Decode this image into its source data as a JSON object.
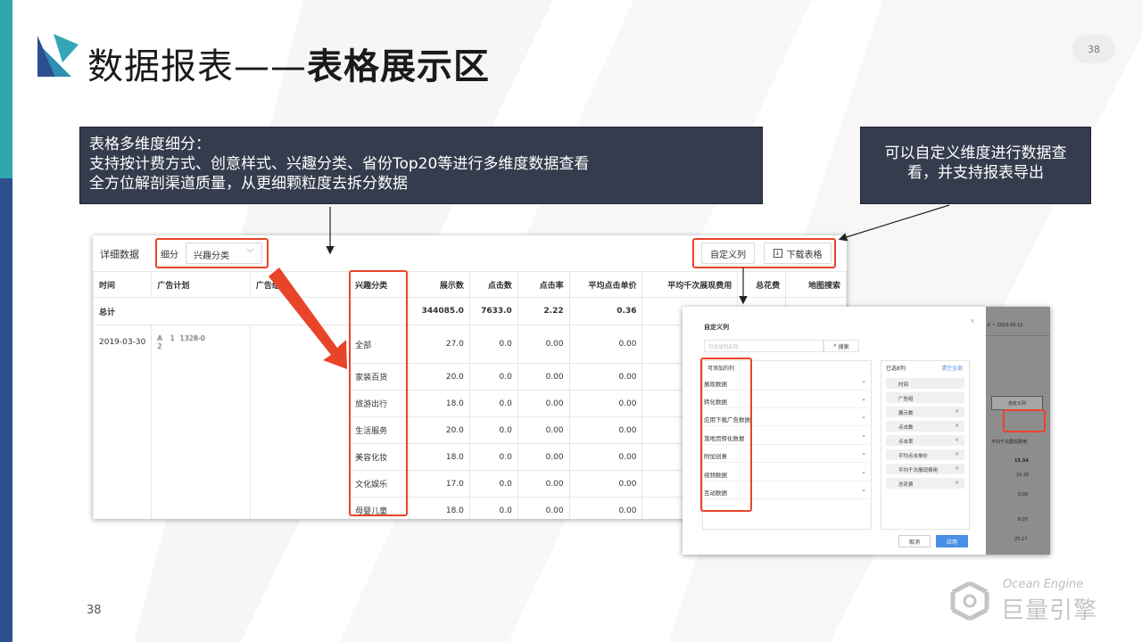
{
  "slide": {
    "title_light": "数据报表——",
    "title_bold": "表格展示区",
    "page_number": "38",
    "brand_en": "Ocean Engine",
    "brand_cn": "巨量引擎"
  },
  "callouts": {
    "left": {
      "line1": "表格多维度细分：",
      "line2": "支持按计费方式、创意样式、兴趣分类、省份Top20等进行多维度数据查看",
      "line3": "全方位解剖渠道质量，从更细颗粒度去拆分数据"
    },
    "right": {
      "line1": "可以自定义维度进行数据查",
      "line2": "看，并支持报表导出"
    }
  },
  "table_panel": {
    "title": "详细数据",
    "segment_label": "细分",
    "segment_value": "兴趣分类",
    "custom_columns_button": "自定义列",
    "download_button": "下载表格",
    "columns": [
      "时间",
      "广告计划",
      "广告组",
      "兴趣分类",
      "展示数",
      "点击数",
      "点击率",
      "平均点击单价",
      "平均千次展现费用",
      "总花费",
      "地图搜索"
    ],
    "total": {
      "label": "总计",
      "impressions": "344085.0",
      "clicks": "7633.0",
      "ctr": "2.22",
      "cpc": "0.36"
    },
    "date": "2019-03-30",
    "plan_name": "A     1   1328-0\n2",
    "group_name": "     ",
    "rows": [
      {
        "category": "全部",
        "impressions": "27.0",
        "clicks": "0.0",
        "ctr": "0.00",
        "cpc": "0.00"
      },
      {
        "category": "家装百货",
        "impressions": "20.0",
        "clicks": "0.0",
        "ctr": "0.00",
        "cpc": "0.00"
      },
      {
        "category": "旅游出行",
        "impressions": "18.0",
        "clicks": "0.0",
        "ctr": "0.00",
        "cpc": "0.00"
      },
      {
        "category": "生活服务",
        "impressions": "20.0",
        "clicks": "0.0",
        "ctr": "0.00",
        "cpc": "0.00"
      },
      {
        "category": "美容化妆",
        "impressions": "18.0",
        "clicks": "0.0",
        "ctr": "0.00",
        "cpc": "0.00"
      },
      {
        "category": "文化娱乐",
        "impressions": "17.0",
        "clicks": "0.0",
        "ctr": "0.00",
        "cpc": "0.00"
      },
      {
        "category": "母婴儿童",
        "impressions": "18.0",
        "clicks": "0.0",
        "ctr": "0.00",
        "cpc": "0.00"
      }
    ]
  },
  "custom_dialog": {
    "title": "自定义列",
    "search_placeholder": "可添加列名称",
    "search_button": "搜索",
    "available_header": "可添加的列",
    "groups": [
      "展现数据",
      "转化数据",
      "应用下载广告数据",
      "落地页转化数据",
      "附加创意",
      "视频数据",
      "互动数据"
    ],
    "selected_header": "已选8列",
    "clear_all": "清空全部",
    "selected": [
      "时间",
      "广告组",
      "展示数",
      "点击数",
      "点击率",
      "平均点击单价",
      "平均千次展现费用",
      "总花费"
    ],
    "cancel_button": "取消",
    "apply_button": "应用",
    "bg_date": "6 ~ 2019-03-12",
    "bg_custom_button": "自定义列",
    "bg_header": "平均千次展现费用",
    "bg_values": [
      "15.54",
      "10.35",
      "0.00",
      "8.07",
      "25.17"
    ]
  },
  "colors": {
    "highlight_red": "#e8442a",
    "callout_bg": "#343c4d",
    "primary_blue": "#4a8fe6",
    "accent_teal": "#2fa5b0",
    "accent_navy": "#2c4f8f"
  }
}
